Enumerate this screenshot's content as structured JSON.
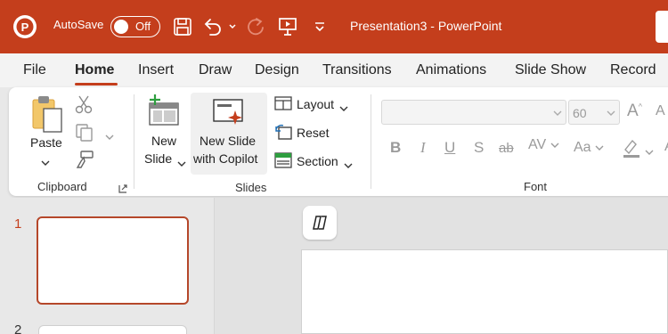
{
  "titlebar": {
    "autosave_label": "AutoSave",
    "autosave_state": "Off",
    "title": "Presentation3 - PowerPoint",
    "color": "#c43e1c"
  },
  "tabs": [
    "File",
    "Home",
    "Insert",
    "Draw",
    "Design",
    "Transitions",
    "Animations",
    "Slide Show",
    "Record"
  ],
  "active_tab": "Home",
  "clipboard": {
    "paste_label": "Paste",
    "group_label": "Clipboard"
  },
  "slides": {
    "new_slide_line1": "New",
    "new_slide_line2": "Slide",
    "copilot_line1": "New Slide",
    "copilot_line2": "with Copilot",
    "layout_label": "Layout",
    "reset_label": "Reset",
    "section_label": "Section",
    "group_label": "Slides"
  },
  "font": {
    "size_value": "60",
    "group_label": "Font",
    "bold": "B",
    "italic": "I",
    "underline": "U",
    "shadow": "S",
    "strike": "ab",
    "spacing": "AV",
    "case": "Aa",
    "grow": "A",
    "shrink": "A"
  },
  "slide_numbers": [
    "1",
    "2"
  ],
  "accent": "#c43e1c"
}
